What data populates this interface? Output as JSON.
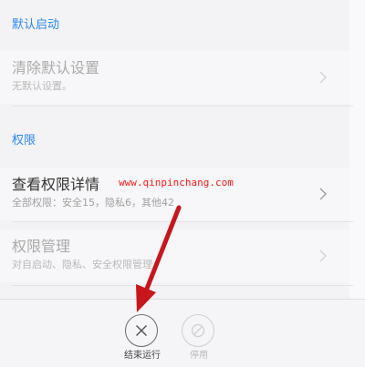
{
  "sections": {
    "default_launch": {
      "header": "默认启动",
      "clear_defaults": {
        "title": "清除默认设置",
        "subtitle": "无默认设置。"
      }
    },
    "permissions": {
      "header": "权限",
      "view_details": {
        "title": "查看权限详情",
        "subtitle": "全部权限：安全15，隐私6，其他42"
      },
      "manage": {
        "title": "权限管理",
        "subtitle": "对自启动、隐私、安全权限管理"
      }
    }
  },
  "watermark": "www.qinpinchang.com",
  "bottom_bar": {
    "end_process": "结束运行",
    "disable": "停用"
  },
  "colors": {
    "accent": "#2c87f5",
    "arrow": "#c8161d",
    "watermark": "#ff1a1a"
  },
  "icons": {
    "chevron": "chevron-right-icon",
    "end_process": "close-icon",
    "disable": "block-icon"
  }
}
